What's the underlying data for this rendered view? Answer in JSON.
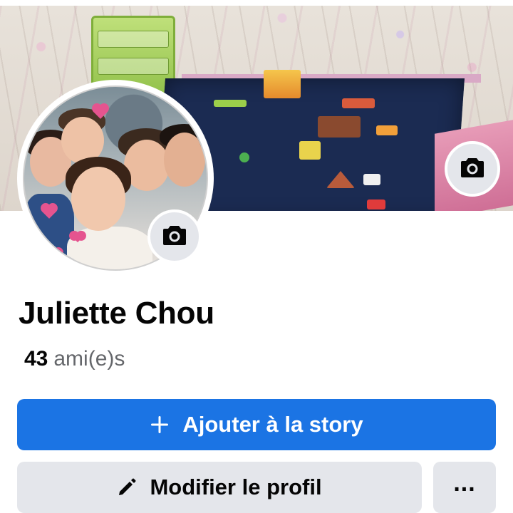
{
  "profile": {
    "name": "Juliette Chou",
    "friends_count": "43",
    "friends_label": "ami(e)s"
  },
  "actions": {
    "add_story_label": "Ajouter à la story",
    "edit_profile_label": "Modifier le profil",
    "more_label": "..."
  },
  "icons": {
    "cover_camera": "camera-icon",
    "avatar_camera": "camera-icon",
    "add": "plus-icon",
    "edit": "pencil-icon"
  },
  "colors": {
    "primary_button": "#1b74e4",
    "secondary_button": "#e4e6eb",
    "text_primary": "#050505",
    "text_secondary": "#65676b"
  }
}
